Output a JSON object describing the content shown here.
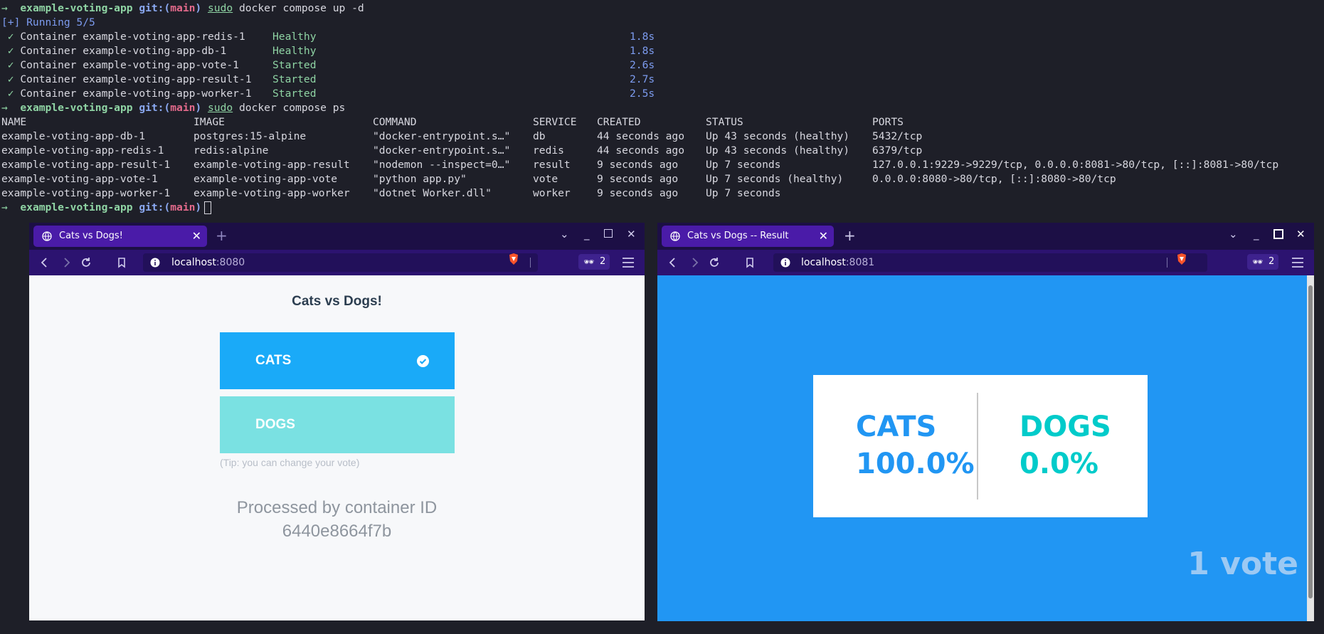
{
  "terminal": {
    "prompt_dir": "example-voting-app",
    "git_label": "git:(",
    "branch": "main",
    "git_close": ")",
    "cmd1_sudo": "sudo",
    "cmd1_rest": " docker compose up -d",
    "running": "[+] Running 5/5",
    "check": "✓",
    "containers": [
      {
        "name": "Container example-voting-app-redis-1 ",
        "status": "Healthy",
        "time": "1.8s"
      },
      {
        "name": "Container example-voting-app-db-1    ",
        "status": "Healthy",
        "time": "1.8s"
      },
      {
        "name": "Container example-voting-app-vote-1  ",
        "status": "Started",
        "time": "2.6s"
      },
      {
        "name": "Container example-voting-app-result-1",
        "status": "Started",
        "time": "2.7s"
      },
      {
        "name": "Container example-voting-app-worker-1",
        "status": "Started",
        "time": "2.5s"
      }
    ],
    "cmd2_sudo": "sudo",
    "cmd2_rest": " docker compose ps",
    "ps_headers": [
      "NAME",
      "IMAGE",
      "COMMAND",
      "SERVICE",
      "CREATED",
      "STATUS",
      "PORTS"
    ],
    "ps_rows": [
      [
        "example-voting-app-db-1",
        "postgres:15-alpine",
        "\"docker-entrypoint.s…\"",
        "db",
        "44 seconds ago",
        "Up 43 seconds (healthy)",
        "5432/tcp"
      ],
      [
        "example-voting-app-redis-1",
        "redis:alpine",
        "\"docker-entrypoint.s…\"",
        "redis",
        "44 seconds ago",
        "Up 43 seconds (healthy)",
        "6379/tcp"
      ],
      [
        "example-voting-app-result-1",
        "example-voting-app-result",
        "\"nodemon --inspect=0…\"",
        "result",
        "9 seconds ago",
        "Up 7 seconds",
        "127.0.0.1:9229->9229/tcp, 0.0.0.0:8081->80/tcp, [::]:8081->80/tcp"
      ],
      [
        "example-voting-app-vote-1",
        "example-voting-app-vote",
        "\"python app.py\"",
        "vote",
        "9 seconds ago",
        "Up 7 seconds (healthy)",
        "0.0.0.0:8080->80/tcp, [::]:8080->80/tcp"
      ],
      [
        "example-voting-app-worker-1",
        "example-voting-app-worker",
        "\"dotnet Worker.dll\"",
        "worker",
        "9 seconds ago",
        "Up 7 seconds",
        ""
      ]
    ]
  },
  "vote_browser": {
    "tab_title": "Cats vs Dogs!",
    "url_host": "localhost",
    "url_port": ":8080",
    "vpn_count": "2",
    "page_title": "Cats vs Dogs!",
    "option_a": "CATS",
    "option_b": "DOGS",
    "tip": "(Tip: you can change your vote)",
    "processed_label": "Processed by container ID",
    "container_id": "6440e8664f7b",
    "colors": {
      "cats": "#1aaaf8",
      "dogs": "#7ae1e2"
    }
  },
  "result_browser": {
    "tab_title": "Cats vs Dogs -- Result",
    "url_host": "localhost",
    "url_port": ":8081",
    "vpn_count": "2",
    "cats_label": "CATS",
    "cats_pct": "100.0%",
    "dogs_label": "DOGS",
    "dogs_pct": "0.0%",
    "votes": "1 vote",
    "colors": {
      "cats": "#2196f3",
      "dogs": "#00cbca"
    }
  }
}
